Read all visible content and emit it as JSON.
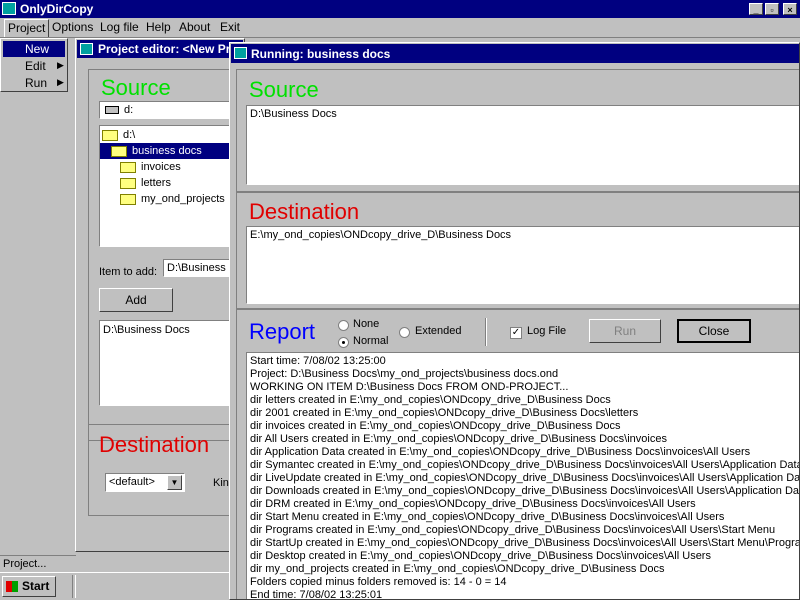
{
  "app": {
    "title": "OnlyDirCopy",
    "menu": [
      "Project",
      "Options",
      "Log file",
      "Help",
      "About",
      "Exit"
    ],
    "project_menu": [
      "New",
      "Edit",
      "Run"
    ]
  },
  "editor": {
    "title": "Project editor: <New Pr",
    "source_heading": "Source",
    "drive_value": "d:",
    "tree": [
      {
        "label": "d:\\",
        "selected": false,
        "open": true,
        "indent": 0
      },
      {
        "label": "business docs",
        "selected": true,
        "open": true,
        "indent": 1
      },
      {
        "label": "invoices",
        "selected": false,
        "open": false,
        "indent": 2
      },
      {
        "label": "letters",
        "selected": false,
        "open": false,
        "indent": 2
      },
      {
        "label": "my_ond_projects",
        "selected": false,
        "open": false,
        "indent": 2
      }
    ],
    "item_to_add_label": "Item to add:",
    "item_to_add_value": "D:\\Business D",
    "add_button": "Add",
    "items": [
      "D:\\Business Docs"
    ],
    "destination_heading": "Destination",
    "destination_select": "<default>",
    "kind_label": "Kin"
  },
  "running": {
    "title": "Running: business docs",
    "source_heading": "Source",
    "source_value": "D:\\Business Docs",
    "destination_heading": "Destination",
    "destination_value": "E:\\my_ond_copies\\ONDcopy_drive_D\\Business Docs",
    "report_heading": "Report",
    "radio_none": "None",
    "radio_normal": "Normal",
    "radio_extended": "Extended",
    "log_file_label": "Log File",
    "run_button": "Run",
    "close_button": "Close",
    "log": [
      "Start time: 7/08/02 13:25:00",
      "Project: D:\\Business Docs\\my_ond_projects\\business docs.ond",
      "WORKING ON ITEM D:\\Business Docs FROM OND-PROJECT...",
      "dir letters created in E:\\my_ond_copies\\ONDcopy_drive_D\\Business Docs",
      "dir 2001 created in E:\\my_ond_copies\\ONDcopy_drive_D\\Business Docs\\letters",
      "dir invoices created in E:\\my_ond_copies\\ONDcopy_drive_D\\Business Docs",
      "dir All Users created in E:\\my_ond_copies\\ONDcopy_drive_D\\Business Docs\\invoices",
      "dir Application Data created in E:\\my_ond_copies\\ONDcopy_drive_D\\Business Docs\\invoices\\All Users",
      "dir Symantec created in E:\\my_ond_copies\\ONDcopy_drive_D\\Business Docs\\invoices\\All Users\\Application Data",
      "dir LiveUpdate created in E:\\my_ond_copies\\ONDcopy_drive_D\\Business Docs\\invoices\\All Users\\Application Data\\",
      "dir Downloads created in E:\\my_ond_copies\\ONDcopy_drive_D\\Business Docs\\invoices\\All Users\\Application Data\\",
      "dir DRM created in E:\\my_ond_copies\\ONDcopy_drive_D\\Business Docs\\invoices\\All Users",
      "dir Start Menu created in E:\\my_ond_copies\\ONDcopy_drive_D\\Business Docs\\invoices\\All Users",
      "dir Programs created in E:\\my_ond_copies\\ONDcopy_drive_D\\Business Docs\\invoices\\All Users\\Start Menu",
      "dir StartUp created in E:\\my_ond_copies\\ONDcopy_drive_D\\Business Docs\\invoices\\All Users\\Start Menu\\Programs",
      "dir Desktop created in E:\\my_ond_copies\\ONDcopy_drive_D\\Business Docs\\invoices\\All Users",
      "dir my_ond_projects created in E:\\my_ond_copies\\ONDcopy_drive_D\\Business Docs",
      "Folders copied minus folders removed is: 14 - 0 = 14",
      "End time: 7/08/02 13:25:01"
    ]
  },
  "statusbar": {
    "text": "Project..."
  },
  "taskbar": {
    "start_label": "Start"
  },
  "colors": {
    "titlebar": "#000080",
    "face": "#c0c0c0",
    "green": "#00e000",
    "red": "#e00000",
    "blue": "#0000ff"
  }
}
